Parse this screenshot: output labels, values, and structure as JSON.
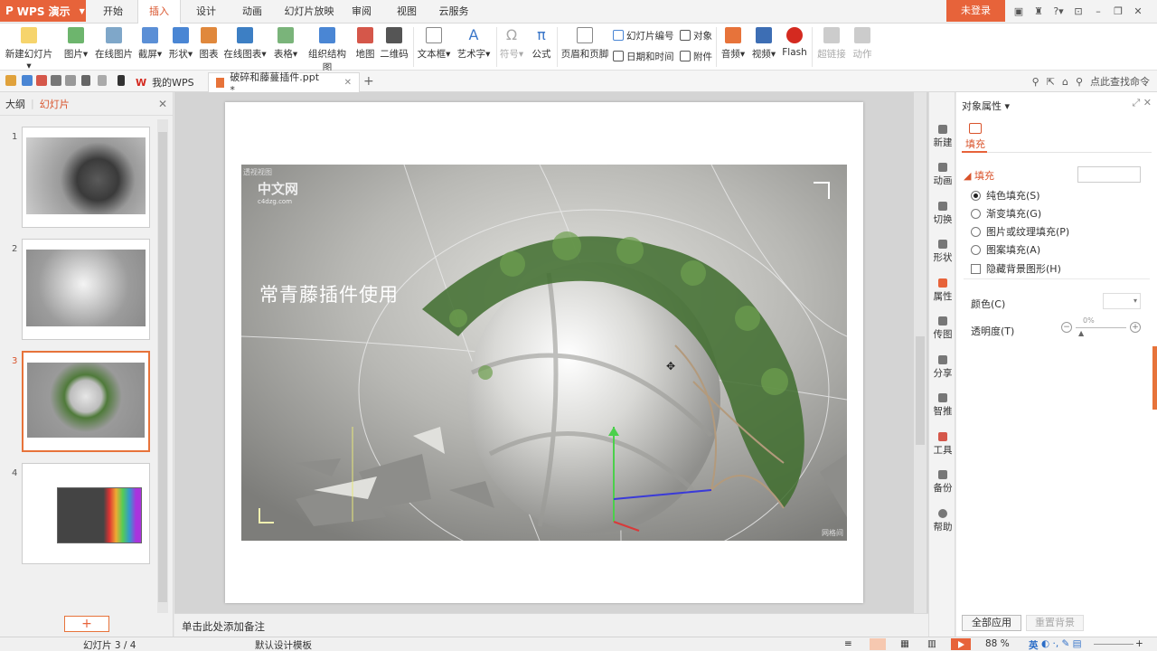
{
  "app": {
    "name": "WPS 演示"
  },
  "menu": {
    "tabs": [
      "开始",
      "插入",
      "设计",
      "动画",
      "幻灯片放映",
      "审阅",
      "视图",
      "云服务"
    ],
    "active_tab": "插入",
    "login": "未登录"
  },
  "ribbon": {
    "new_slide": "新建幻灯片",
    "picture": "图片",
    "online_picture": "在线图片",
    "screenshot": "截屏",
    "shape": "形状",
    "chart": "图表",
    "online_chart": "在线图表",
    "table": "表格",
    "org_chart": "组织结构图",
    "map": "地图",
    "qrcode": "二维码",
    "textbox": "文本框",
    "wordart": "艺术字",
    "symbol": "符号",
    "formula": "公式",
    "header_footer": "页眉和页脚",
    "slide_number": "幻灯片编号",
    "object": "对象",
    "datetime": "日期和时间",
    "attachment": "附件",
    "audio": "音频",
    "video": "视频",
    "flash": "Flash",
    "hyperlink": "超链接",
    "action": "动作"
  },
  "tabs": {
    "my_wps": "我的WPS",
    "document": "破碎和藤蔓插件.ppt *",
    "find_command": "点此查找命令"
  },
  "left_panel": {
    "tab_outline": "大纲",
    "tab_slides": "幻灯片",
    "slide_numbers": [
      "1",
      "2",
      "3",
      "4"
    ],
    "active_slide": "3"
  },
  "slide": {
    "title": "常青藤插件使用",
    "viewport_label": "透视视图",
    "logo_text": "中文网",
    "logo_sub": "c4dzg.com",
    "watermark": "网格间"
  },
  "notes": {
    "placeholder": "单击此处添加备注"
  },
  "side_tools": [
    "新建",
    "动画",
    "切换",
    "形状",
    "属性",
    "传图",
    "分享",
    "智推",
    "工具",
    "备份",
    "帮助"
  ],
  "side_tools_active": "属性",
  "props": {
    "title": "对象属性",
    "tab_fill": "填充",
    "section_fill": "填充",
    "options": [
      "纯色填充(S)",
      "渐变填充(G)",
      "图片或纹理填充(P)",
      "图案填充(A)"
    ],
    "selected_option": "纯色填充(S)",
    "hide_bg": "隐藏背景图形(H)",
    "color_label": "颜色(C)",
    "transparency_label": "透明度(T)",
    "transparency_value": "0%",
    "apply_all": "全部应用",
    "reset_bg": "重置背景"
  },
  "status": {
    "slide_counter": "幻灯片 3 / 4",
    "template": "默认设计模板",
    "zoom": "88 %",
    "ime": "英"
  },
  "colors": {
    "accent": "#e7633a",
    "menu_active_text": "#d9532b"
  }
}
